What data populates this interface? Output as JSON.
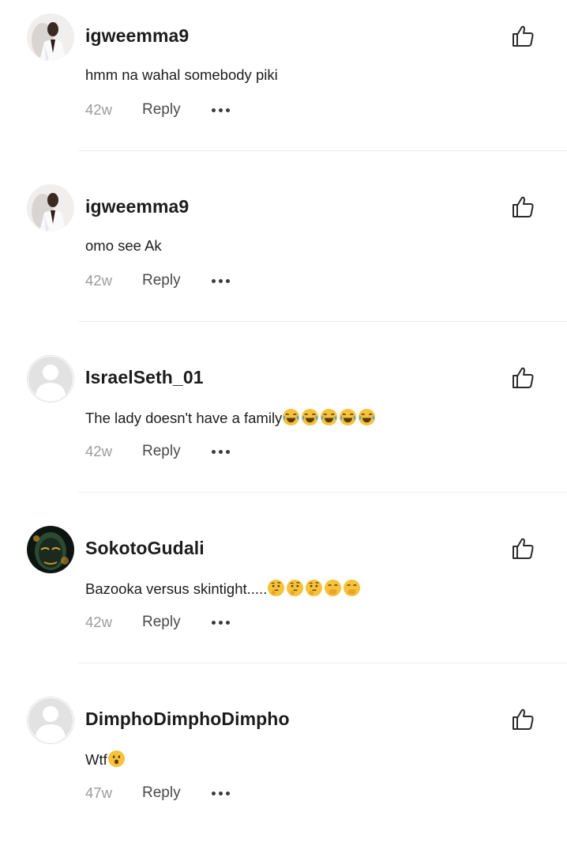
{
  "comments": [
    {
      "username": "igweemma9",
      "text": "hmm na wahal somebody piki",
      "emoji": [],
      "time": "42w",
      "reply_label": "Reply",
      "avatar": "photo-man",
      "icons": {
        "like": "thumbs-up-icon",
        "more": "more-dots-icon"
      }
    },
    {
      "username": "igweemma9",
      "text": "omo see Ak",
      "emoji": [],
      "time": "42w",
      "reply_label": "Reply",
      "avatar": "photo-man",
      "icons": {
        "like": "thumbs-up-icon",
        "more": "more-dots-icon"
      }
    },
    {
      "username": "IsraelSeth_01",
      "text": "The lady doesn't have a family",
      "emoji": [
        "😂",
        "😂",
        "😂",
        "😂",
        "😂"
      ],
      "time": "42w",
      "reply_label": "Reply",
      "avatar": "default-user",
      "icons": {
        "like": "thumbs-up-icon",
        "more": "more-dots-icon"
      }
    },
    {
      "username": "SokotoGudali",
      "text": "Bazooka versus skintight.....",
      "emoji": [
        "🤔",
        "🤔",
        "🤔",
        "🤭",
        "🤭"
      ],
      "time": "42w",
      "reply_label": "Reply",
      "avatar": "photo-dark",
      "icons": {
        "like": "thumbs-up-icon",
        "more": "more-dots-icon"
      }
    },
    {
      "username": "DimphoDimphoDimpho",
      "text": "Wtf",
      "emoji": [
        "😮"
      ],
      "time": "47w",
      "reply_label": "Reply",
      "avatar": "default-user",
      "icons": {
        "like": "thumbs-up-icon",
        "more": "more-dots-icon"
      }
    }
  ],
  "colors": {
    "background": "#ffffff",
    "username": "#1c1c1c",
    "text": "#1c1c1c",
    "timestamp": "#9b9b9b",
    "reply": "#4a4a4a",
    "divider": "#ececec",
    "default_avatar": "#e2e2e2"
  }
}
